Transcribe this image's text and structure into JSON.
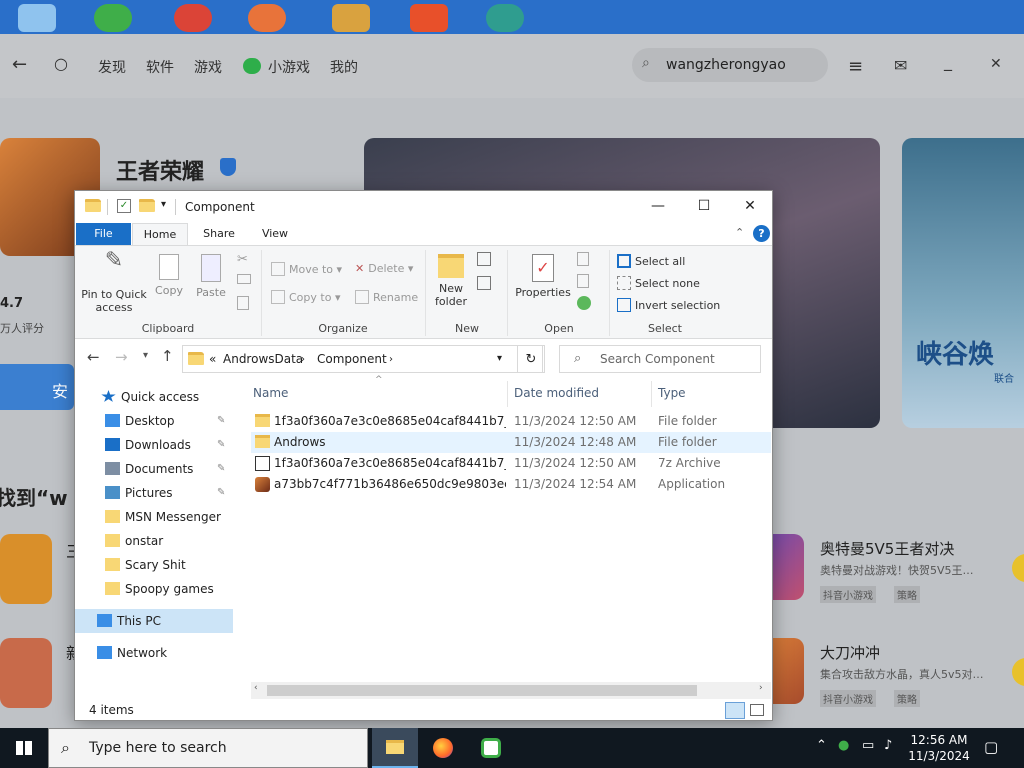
{
  "store": {
    "nav": {
      "back": "←",
      "refresh": "○",
      "items": [
        "发现",
        "软件",
        "游戏",
        "小游戏",
        "我的"
      ]
    },
    "search_value": "wangzherongyao",
    "app_title": "王者荣耀",
    "rating": "4.7",
    "rating_caption": "万人评分",
    "install_button": "安",
    "section_heading": "找到“w",
    "right_banner_text": "峡谷焕",
    "right_banner_sub": "联合",
    "results": [
      {
        "title": "奥特曼5V5王者对决",
        "desc": "奥特曼对战游戏！快贺5V5王…",
        "tags": [
          "抖音小游戏",
          "策略"
        ]
      },
      {
        "title": "大刀冲冲",
        "desc": "集合攻击敌方水晶，真人5v5对…",
        "tags": [
          "抖音小游戏",
          "策略"
        ]
      }
    ],
    "left_fragments": [
      "三",
      "新"
    ]
  },
  "explorer": {
    "title": "Component",
    "window_buttons": {
      "minimize": "—",
      "maximize": "☐",
      "close": "✕"
    },
    "ribbon_tabs": [
      "File",
      "Home",
      "Share",
      "View"
    ],
    "help": "?",
    "ribbon": {
      "clipboard": {
        "label": "Clipboard",
        "pin": "Pin to Quick access",
        "copy": "Copy",
        "paste": "Paste"
      },
      "organize": {
        "label": "Organize",
        "move_to": "Move to",
        "copy_to": "Copy to",
        "delete": "Delete",
        "rename": "Rename"
      },
      "new": {
        "label": "New",
        "new_folder": "New folder"
      },
      "open": {
        "label": "Open",
        "properties": "Properties"
      },
      "select": {
        "label": "Select",
        "select_all": "Select all",
        "select_none": "Select none",
        "invert": "Invert selection"
      }
    },
    "address": {
      "prefix": "«",
      "crumbs": [
        "AndrowsData",
        "Component"
      ]
    },
    "search_placeholder": "Search Component",
    "nav_pane": [
      {
        "label": "Quick access",
        "icon": "star-icon",
        "pinned": false
      },
      {
        "label": "Desktop",
        "icon": "desktop-icon",
        "pinned": true
      },
      {
        "label": "Downloads",
        "icon": "download-icon",
        "pinned": true
      },
      {
        "label": "Documents",
        "icon": "documents-icon",
        "pinned": true
      },
      {
        "label": "Pictures",
        "icon": "pictures-icon",
        "pinned": true
      },
      {
        "label": "MSN Messenger",
        "icon": "folder-icon",
        "pinned": false
      },
      {
        "label": "onstar",
        "icon": "folder-icon",
        "pinned": false
      },
      {
        "label": "Scary Shit",
        "icon": "folder-icon",
        "pinned": false
      },
      {
        "label": "Spoopy games",
        "icon": "folder-icon",
        "pinned": false
      },
      {
        "label": "This PC",
        "icon": "pc-icon",
        "pinned": false
      },
      {
        "label": "Network",
        "icon": "network-icon",
        "pinned": false
      }
    ],
    "columns": {
      "name": "Name",
      "date": "Date modified",
      "type": "Type"
    },
    "files": [
      {
        "name": "1f3a0f360a7e3c0e8685e04caf8441b7_3.0.3...",
        "date": "11/3/2024 12:50 AM",
        "type": "File folder",
        "icon": "folder-icon"
      },
      {
        "name": "Androws",
        "date": "11/3/2024 12:48 AM",
        "type": "File folder",
        "icon": "folder-icon"
      },
      {
        "name": "1f3a0f360a7e3c0e8685e04caf8441b7_3.0.3...",
        "date": "11/3/2024 12:50 AM",
        "type": "7z Archive",
        "icon": "archive-icon"
      },
      {
        "name": "a73bb7c4f771b36486e650dc9e9803ec__co...",
        "date": "11/3/2024 12:54 AM",
        "type": "Application",
        "icon": "app-icon"
      }
    ],
    "item_count": "4 items"
  },
  "taskbar": {
    "search_placeholder": "Type here to search",
    "time": "12:56 AM",
    "date": "11/3/2024"
  },
  "colors": {
    "accent": "#1a6fc7",
    "folder": "#f8d775",
    "selection": "#cce4f7",
    "hover": "#e5f3ff"
  }
}
